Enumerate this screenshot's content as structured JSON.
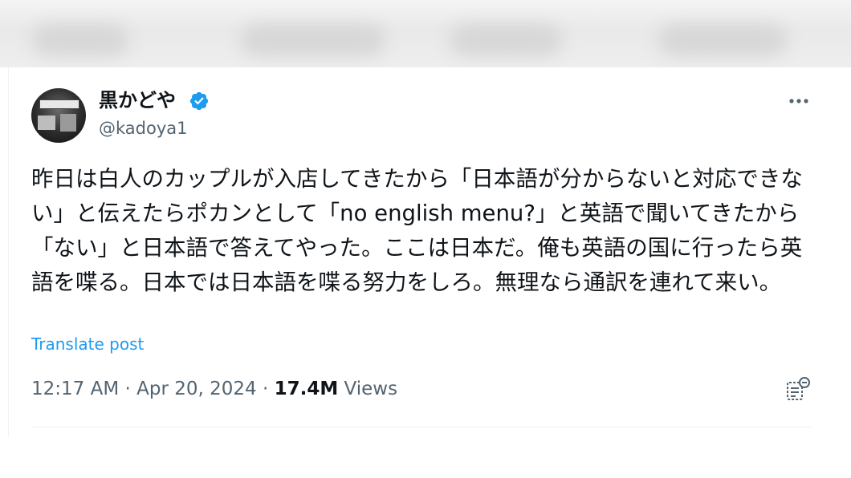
{
  "post": {
    "author_name": "黒かどや",
    "author_handle": "@kadoya1",
    "text": "昨日は白人のカップルが入店してきたから「日本語が分からないと対応できない」と伝えたらポカンとして「no english menu?」と英語で聞いてきたから「ない」と日本語で答えてやった。ここは日本だ。俺も英語の国に行ったら英語を喋る。日本では日本語を喋る努力をしろ。無理なら通訳を連れて来い。",
    "translate_label": "Translate post",
    "time": "12:17 AM",
    "date": "Apr 20, 2024",
    "separator": " · ",
    "views_count": "17.4M",
    "views_label": " Views"
  },
  "icons": {
    "verified": "verified-badge-icon",
    "more": "more-options-icon",
    "analytics": "view-analytics-icon",
    "avatar": "avatar"
  },
  "colors": {
    "accent": "#1d9bf0",
    "secondary_text": "#536471",
    "primary_text": "#0f1419"
  }
}
